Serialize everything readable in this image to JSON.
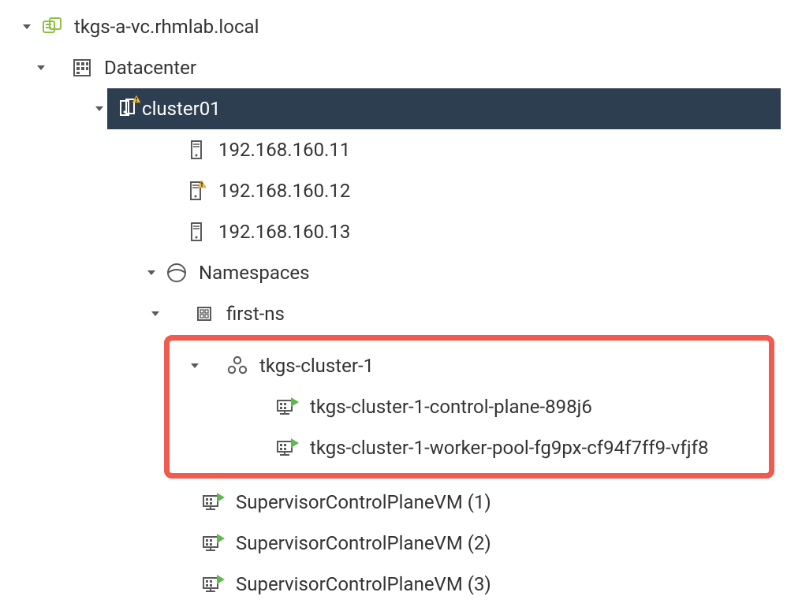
{
  "vcenter": {
    "name": "tkgs-a-vc.rhmlab.local"
  },
  "datacenter": {
    "name": "Datacenter"
  },
  "cluster": {
    "name": "cluster01",
    "hosts": [
      "192.168.160.11",
      "192.168.160.12",
      "192.168.160.13"
    ]
  },
  "namespaces": {
    "label": "Namespaces",
    "first_ns": "first-ns",
    "tkgs_cluster": "tkgs-cluster-1",
    "tkgs_vms": [
      "tkgs-cluster-1-control-plane-898j6",
      "tkgs-cluster-1-worker-pool-fg9px-cf94f7ff9-vfjf8"
    ],
    "supervisors": [
      "SupervisorControlPlaneVM (1)",
      "SupervisorControlPlaneVM (2)",
      "SupervisorControlPlaneVM (3)"
    ]
  },
  "colors": {
    "selection_bg": "#2d3e50",
    "highlight_border": "#f15a4e",
    "vcenter_icon": "#8fc03f",
    "running_green": "#5fb84c",
    "warning_yellow": "#f5bf42"
  }
}
